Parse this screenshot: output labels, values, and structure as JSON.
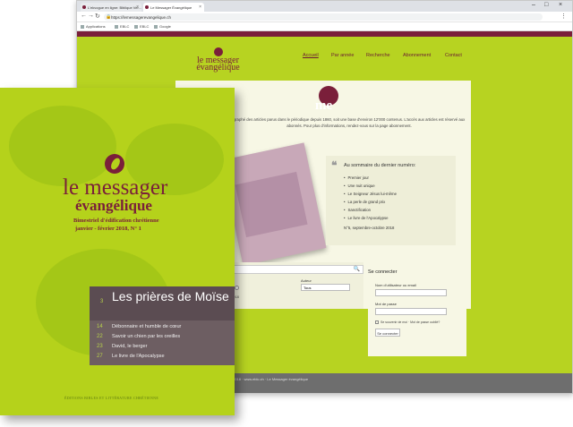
{
  "browser": {
    "tabs": [
      {
        "label": "L'ekvogue en ligne: Biblique Ver...",
        "active": false
      },
      {
        "label": "Le Messager Évangélique",
        "active": true
      }
    ],
    "url": "https://lemessagerevangelique.ch",
    "bookmarks": [
      "Applications",
      "EBLC",
      "EBLC",
      "Google"
    ]
  },
  "site": {
    "logo_line1": "le messager",
    "logo_line2": "évangélique",
    "nav": [
      "Accueil",
      "Par année",
      "Recherche",
      "Abonnement",
      "Contact"
    ],
    "me_text": "me",
    "intro": "graphé des articles parus dans le périodique depuis 1860, soit une base d'environ 12'000 contenus. L'accès aux articles est réservé aux abonnés. Pour plus d'informations, rendez-vous sur la page abonnement.",
    "summary_title": "Au sommaire du dernier numéro:",
    "summary_items": [
      "Premier jour",
      "Une nuit unique",
      "Le Seigneur Jésus lui-même",
      "La perle de grand prix",
      "Sanctification",
      "Le livre de l'Apocalypse"
    ],
    "issue": "N°5, septembre-octobre 2018",
    "search": {
      "year_label": "Année",
      "author_label": "Auteur",
      "year_min": "1860",
      "year_max": "2018",
      "author_value": "Tous"
    },
    "login": {
      "title": "Se connecter",
      "user_label": "Nom d'utilisateur ou email",
      "pass_label": "Mot de passe",
      "remember": "Se souvenir de moi · Mot de passe oublié?",
      "button": "Se connecter"
    },
    "footer": "© 2018 · www.eblc.ch · Le Messager évangélique"
  },
  "cover": {
    "title_line1": "le messager",
    "title_line2": "évangélique",
    "subtitle1": "Bimestriel d'édification chrétienne",
    "subtitle2": "janvier - février 2018, N° 1",
    "toc_main_num": "3",
    "toc_main_title": "Les prières de Moïse",
    "toc_items": [
      {
        "num": "14",
        "text": "Débonnaire et humble de cœur"
      },
      {
        "num": "22",
        "text": "Savoir un chien par les oreilles"
      },
      {
        "num": "23",
        "text": "David, le berger"
      },
      {
        "num": "27",
        "text": "Le livre de l'Apocalypse"
      }
    ],
    "publisher": "ÉDITIONS BIBLES ET LITTÉRATURE CHRÉTIENNE"
  }
}
